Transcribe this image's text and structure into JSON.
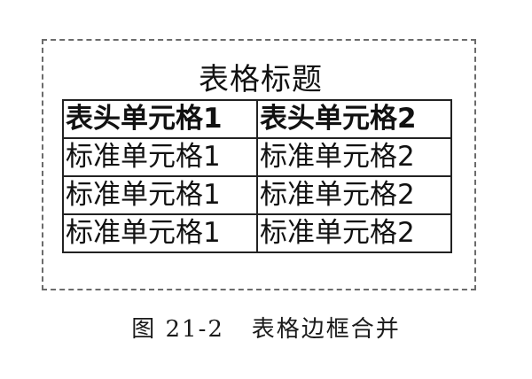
{
  "table": {
    "caption": "表格标题",
    "headers": [
      "表头单元格1",
      "表头单元格2"
    ],
    "rows": [
      [
        "标准单元格1",
        "标准单元格2"
      ],
      [
        "标准单元格1",
        "标准单元格2"
      ],
      [
        "标准单元格1",
        "标准单元格2"
      ]
    ]
  },
  "figure_caption": "图 21-2   表格边框合并"
}
